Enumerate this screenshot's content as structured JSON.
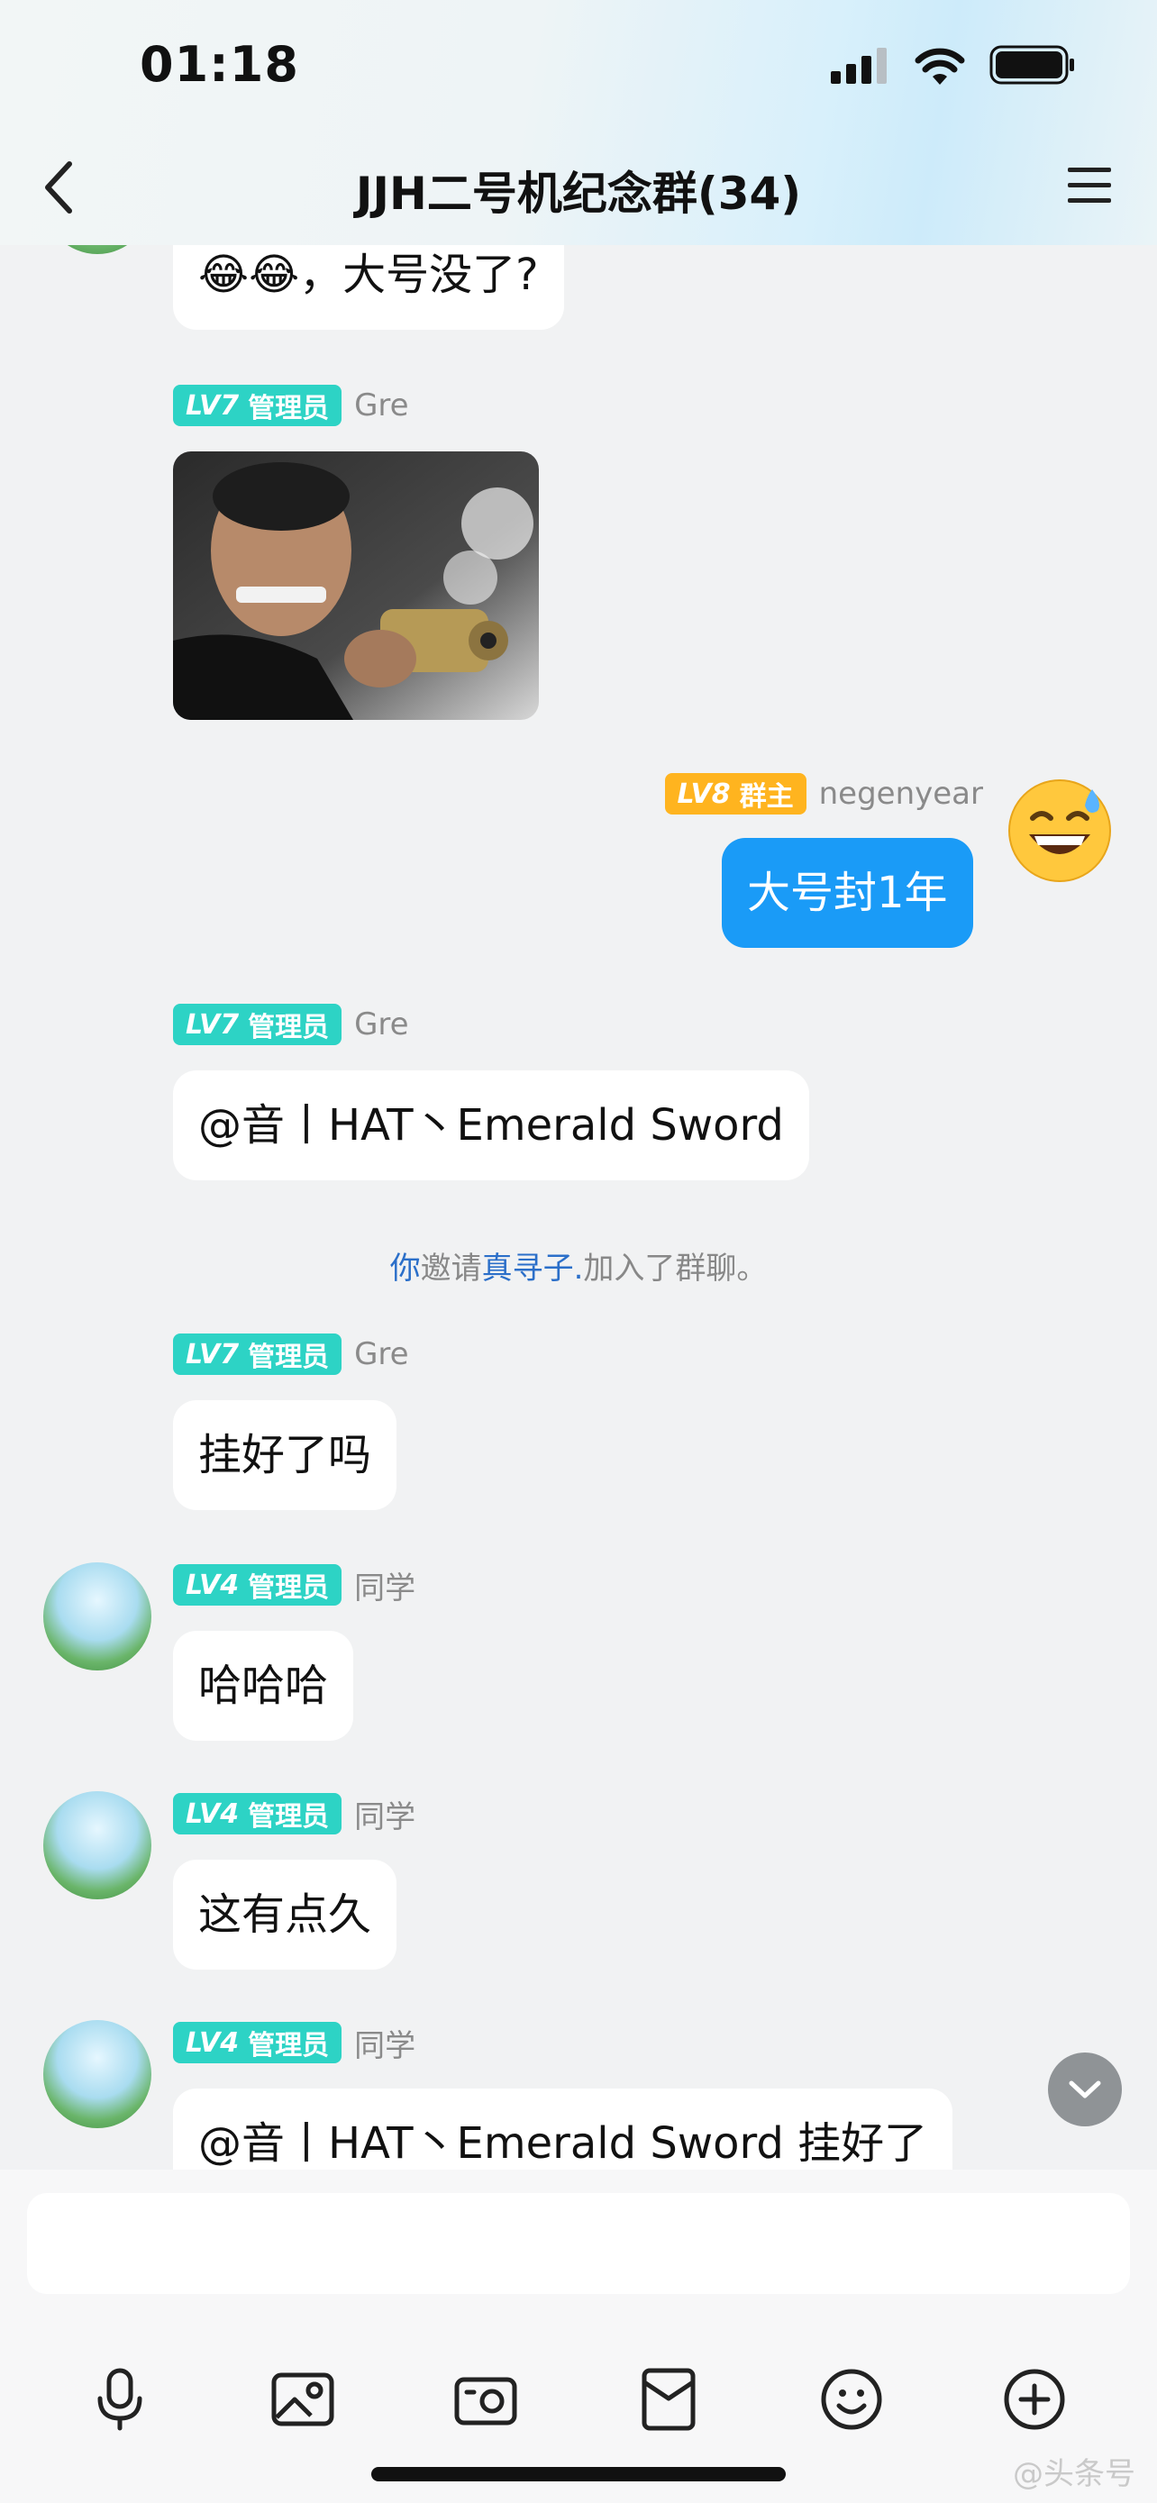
{
  "status_bar": {
    "time": "01:18"
  },
  "nav": {
    "title": "JJH二号机纪念群(34)"
  },
  "messages": [
    {
      "text": "😂😂，大号没了?"
    },
    {
      "level": "LV7",
      "role": "管理员",
      "sender": "Gre"
    },
    {
      "level": "LV8",
      "role": "群主",
      "sender": "negenyear",
      "text": "大号封1年"
    },
    {
      "level": "LV7",
      "role": "管理员",
      "sender": "Gre",
      "text": "@音丨HAT丶Emerald Sword"
    },
    {
      "level": "LV7",
      "role": "管理员",
      "sender": "Gre",
      "text": "挂好了吗"
    },
    {
      "level": "LV4",
      "role": "管理员",
      "sender": "同学",
      "text": "哈哈哈"
    },
    {
      "level": "LV4",
      "role": "管理员",
      "sender": "同学",
      "text": "这有点久"
    },
    {
      "level": "LV4",
      "role": "管理员",
      "sender": "同学",
      "text": "@音丨HAT丶Emerald Sword 挂好了"
    }
  ],
  "system": {
    "you": "你",
    "invite": "邀请",
    "name": "真寻子.",
    "joined": "加入了群聊。"
  },
  "watermark": "@头条号"
}
